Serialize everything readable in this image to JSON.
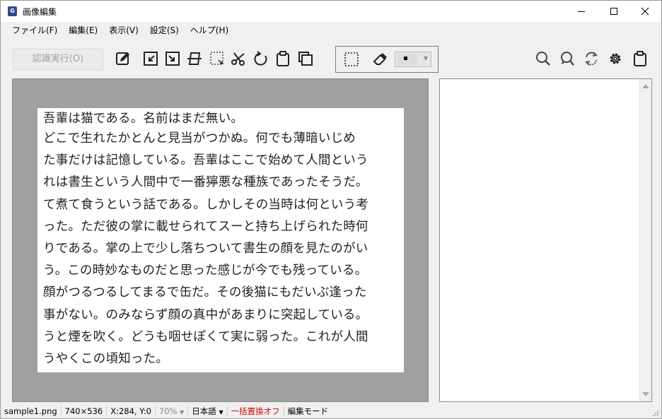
{
  "window": {
    "title": "画像編集",
    "app_icon": "app-icon",
    "controls": [
      "minimize-icon",
      "maximize-icon",
      "close-icon"
    ]
  },
  "menu": [
    {
      "label": "ファイル(F)"
    },
    {
      "label": "編集(E)"
    },
    {
      "label": "表示(V)"
    },
    {
      "label": "設定(S)"
    },
    {
      "label": "ヘルプ(H)"
    }
  ],
  "toolbar": {
    "ocr_button": "認識実行(O)",
    "tools": [
      "edit-icon",
      "crop-left-icon",
      "crop-right-icon",
      "flip-icon",
      "selection-corner-icon",
      "scissors-icon",
      "rotate-icon",
      "paste-icon",
      "copy-icon"
    ],
    "edit_tools": [
      "rect-select-icon",
      "eraser-icon",
      "color-picker"
    ],
    "right_tools": [
      "search-icon",
      "search-replace-icon",
      "refresh-icon",
      "gear-icon",
      "clipboard-icon"
    ]
  },
  "image": {
    "lines": [
      "吾輩は猫である。名前はまだ無い。",
      "どこで生れたかとんと見当がつかぬ。何でも薄暗いじめ",
      "た事だけは記憶している。吾輩はここで始めて人間という",
      "れは書生という人間中で一番獰悪な種族であったそうだ。",
      "て煮て食うという話である。しかしその当時は何という考",
      "った。ただ彼の掌に載せられてスーと持ち上げられた時何",
      "りである。掌の上で少し落ちついて書生の顔を見たのがい",
      "う。この時妙なものだと思った感じが今でも残っている。",
      "顔がつるつるしてまるで缶だ。その後猫にもだいぶ逢った",
      "事がない。のみならず顔の真中があまりに突起している。",
      "うと煙を吹く。どうも咽せぽくて実に弱った。これが人間",
      "うやくこの頃知った。"
    ]
  },
  "status": {
    "filename": "sample1.png",
    "dimensions": "740×536",
    "coords": "X:284, Y:0",
    "zoom": "70%",
    "language": "日本語",
    "replace": "一括置換オフ",
    "mode": "編集モード"
  },
  "colors": {
    "replace_status": "#cc0000",
    "image_background": "#a0a0a0"
  }
}
